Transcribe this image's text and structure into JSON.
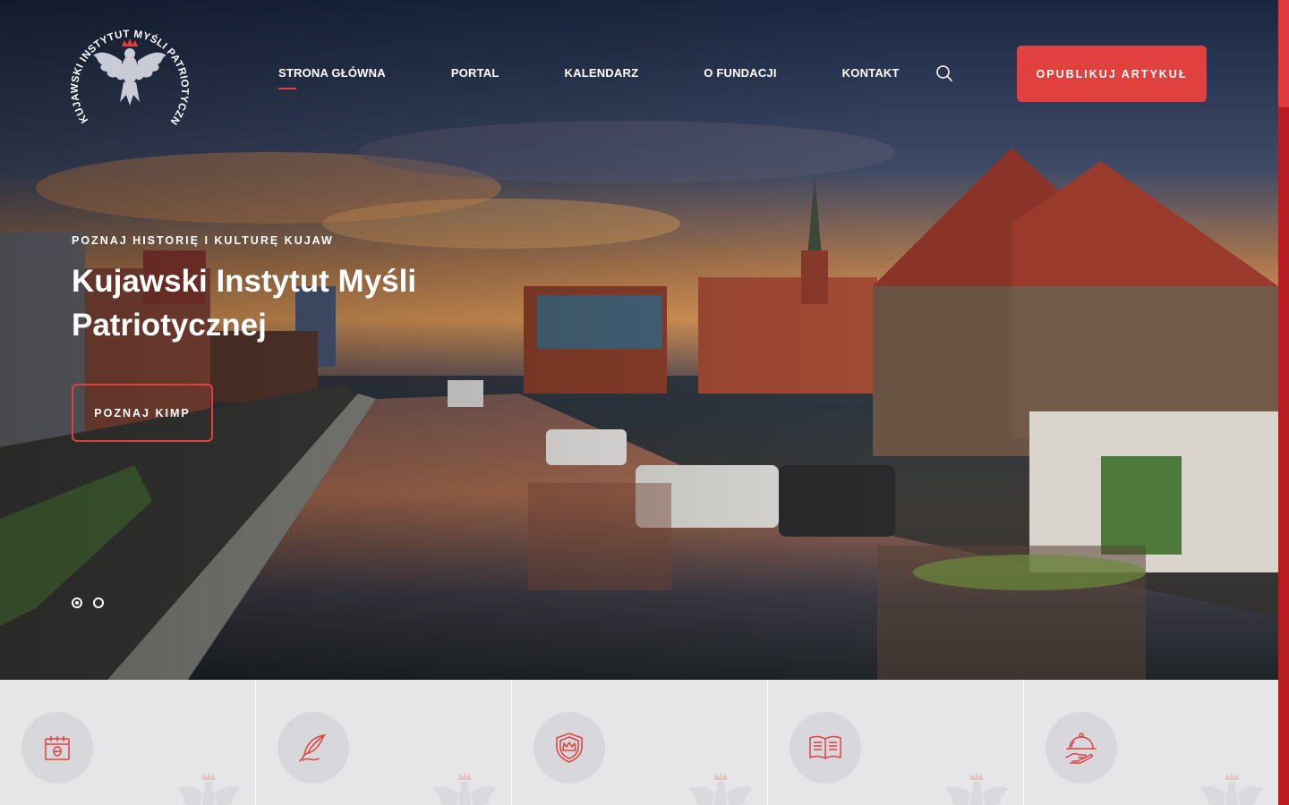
{
  "header": {
    "logo_text": "KUJAWSKI INSTYTUT MYŚLI PATRIOTYCZNEJ",
    "nav": [
      {
        "label": "STRONA GŁÓWNA",
        "active": true
      },
      {
        "label": "PORTAL",
        "active": false
      },
      {
        "label": "KALENDARZ",
        "active": false
      },
      {
        "label": "O FUNDACJI",
        "active": false
      },
      {
        "label": "KONTAKT",
        "active": false
      }
    ],
    "search_icon": "search-icon",
    "cta_label": "OPUBLIKUJ ARTYKUŁ"
  },
  "hero": {
    "eyebrow": "POZNAJ HISTORIĘ I KULTURĘ KUJAW",
    "title": "Kujawski Instytut Myśli Patriotycznej",
    "button_label": "POZNAJ KIMP",
    "slides_total": 2,
    "active_slide": 1
  },
  "cards": [
    {
      "icon": "calendar-icon"
    },
    {
      "icon": "quill-feather-icon"
    },
    {
      "icon": "shield-crown-icon"
    },
    {
      "icon": "open-book-icon"
    },
    {
      "icon": "serving-cloche-icon"
    }
  ],
  "colors": {
    "accent": "#e0413f",
    "card_bg": "#e6e6e8",
    "icon_circle": "#d8d8dc",
    "scrollbar": "#b81c22"
  }
}
